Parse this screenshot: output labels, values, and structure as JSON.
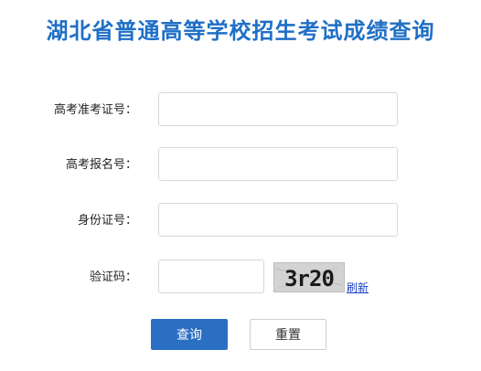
{
  "title": "湖北省普通高等学校招生考试成绩查询",
  "form": {
    "fields": [
      {
        "label": "高考准考证号：",
        "value": "",
        "placeholder": ""
      },
      {
        "label": "高考报名号：",
        "value": "",
        "placeholder": ""
      },
      {
        "label": "身份证号：",
        "value": "",
        "placeholder": ""
      },
      {
        "label": "验证码：",
        "value": "",
        "placeholder": ""
      }
    ],
    "captcha_text": "3r20",
    "refresh_label": "刷新"
  },
  "buttons": {
    "query_label": "查询",
    "reset_label": "重置"
  },
  "colors": {
    "title": "#1f6fc5",
    "primary_button": "#2b6fc3",
    "link": "#1a3fc4"
  }
}
